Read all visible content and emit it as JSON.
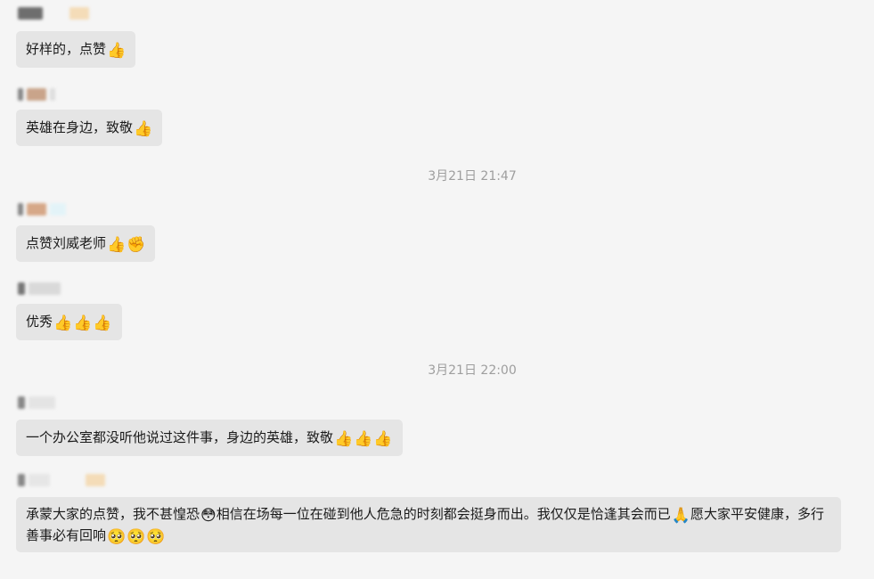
{
  "messages": [
    {
      "text": "好样的，点赞",
      "emoji": [
        "👍"
      ]
    },
    {
      "text": "英雄在身边，致敬",
      "emoji": [
        "👍"
      ]
    },
    {
      "text": "点赞刘威老师",
      "emoji": [
        "👍",
        "✊"
      ]
    },
    {
      "text": "优秀",
      "emoji": [
        "👍",
        "👍",
        "👍"
      ]
    },
    {
      "text": "一个办公室都没听他说过这件事，身边的英雄，致敬",
      "emoji": [
        "👍",
        "👍",
        "👍"
      ]
    },
    {
      "text_a": "承蒙大家的点赞，我不甚惶恐",
      "emoji_a": "😳",
      "text_b": "相信在场每一位在碰到他人危急的时刻都会挺身而出。我仅仅是恰逢其会而已",
      "emoji_b": "🙏",
      "text_c": "愿大家平安健康，多行善事必有回响",
      "emoji_c": [
        "🥺",
        "🥺",
        "🥺"
      ]
    }
  ],
  "timestamps": [
    "3月21日 21:47",
    "3月21日 22:00"
  ],
  "colors": {
    "background": "#f5f5f5",
    "bubble": "#e5e5e5",
    "timestamp": "#9e9e9e"
  }
}
